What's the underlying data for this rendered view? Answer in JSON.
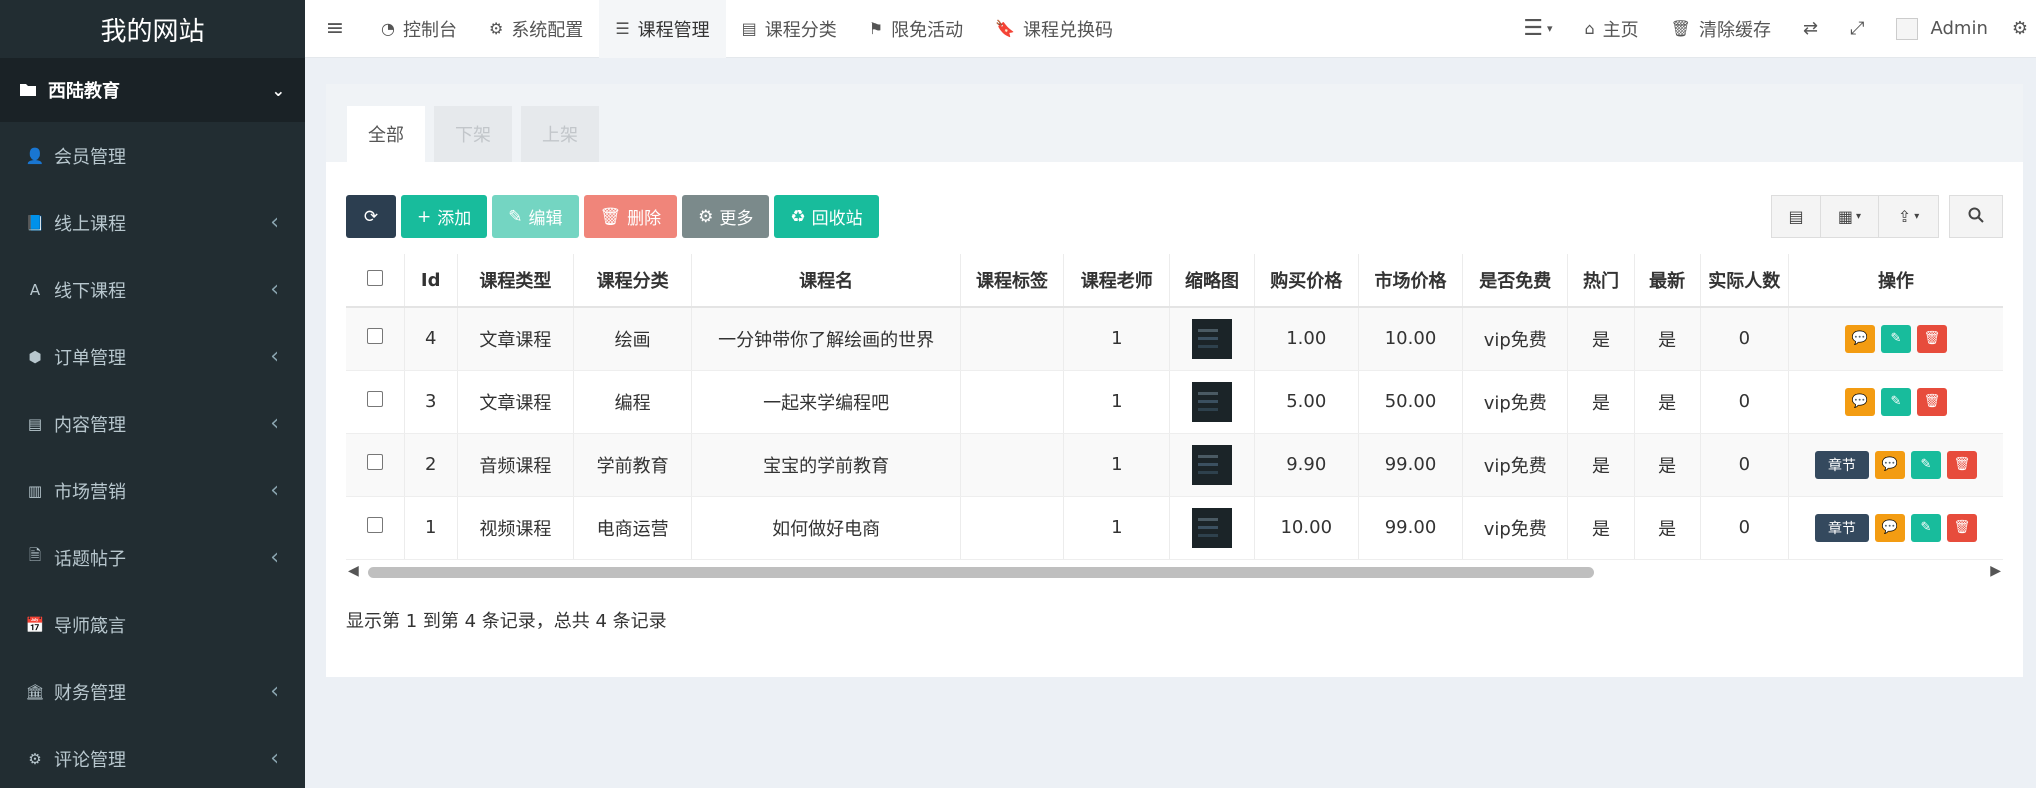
{
  "sidebar": {
    "logo": "我的网站",
    "group": {
      "label": "西陆教育",
      "icon": "folder-icon"
    },
    "items": [
      {
        "label": "会员管理",
        "icon": "user-icon",
        "has_arrow": false
      },
      {
        "label": "线上课程",
        "icon": "book-icon",
        "has_arrow": true
      },
      {
        "label": "线下课程",
        "icon": "font-icon",
        "has_arrow": true
      },
      {
        "label": "订单管理",
        "icon": "cube-icon",
        "has_arrow": true
      },
      {
        "label": "内容管理",
        "icon": "list-alt-icon",
        "has_arrow": true
      },
      {
        "label": "市场营销",
        "icon": "bar-chart-icon",
        "has_arrow": true
      },
      {
        "label": "话题帖子",
        "icon": "file-icon",
        "has_arrow": true
      },
      {
        "label": "导师箴言",
        "icon": "calendar-icon",
        "has_arrow": false
      },
      {
        "label": "财务管理",
        "icon": "bank-icon",
        "has_arrow": true
      },
      {
        "label": "评论管理",
        "icon": "gear-icon",
        "has_arrow": true
      }
    ]
  },
  "topnav": {
    "tabs": [
      {
        "label": "控制台",
        "icon": "dashboard-icon"
      },
      {
        "label": "系统配置",
        "icon": "gear-icon"
      },
      {
        "label": "课程管理",
        "icon": "list-icon",
        "active": true
      },
      {
        "label": "课程分类",
        "icon": "list-alt-icon"
      },
      {
        "label": "限免活动",
        "icon": "flag-icon"
      },
      {
        "label": "课程兑换码",
        "icon": "bookmark-icon"
      }
    ],
    "right": {
      "home": "主页",
      "clear_cache": "清除缓存",
      "user": "Admin"
    }
  },
  "content": {
    "tabs": {
      "all": "全部",
      "off": "下架",
      "on": "上架"
    },
    "toolbar": {
      "add": "添加",
      "edit": "编辑",
      "delete": "删除",
      "more": "更多",
      "recycle": "回收站"
    },
    "table": {
      "headers": [
        "Id",
        "课程类型",
        "课程分类",
        "课程名",
        "课程标签",
        "课程老师",
        "缩略图",
        "购买价格",
        "市场价格",
        "是否免费",
        "热门",
        "最新",
        "实际人数",
        "操作"
      ],
      "rows": [
        {
          "id": "4",
          "type": "文章课程",
          "type_color": "red",
          "category": "绘画",
          "name": "一分钟带你了解绘画的世界",
          "tag": "",
          "teacher": "1",
          "price": "1.00",
          "market": "10.00",
          "free": "vip免费",
          "hot": "是",
          "new": "是",
          "count": "0",
          "chapter": ""
        },
        {
          "id": "3",
          "type": "文章课程",
          "type_color": "red",
          "category": "编程",
          "name": "一起来学编程吧",
          "tag": "",
          "teacher": "1",
          "price": "5.00",
          "market": "50.00",
          "free": "vip免费",
          "hot": "是",
          "new": "是",
          "count": "0",
          "chapter": ""
        },
        {
          "id": "2",
          "type": "音频课程",
          "type_color": "green",
          "category": "学前教育",
          "name": "宝宝的学前教育",
          "tag": "",
          "teacher": "1",
          "price": "9.90",
          "market": "99.00",
          "free": "vip免费",
          "hot": "是",
          "new": "是",
          "count": "0",
          "chapter": "章节"
        },
        {
          "id": "1",
          "type": "视频课程",
          "type_color": "plain",
          "category": "电商运营",
          "name": "如何做好电商",
          "tag": "",
          "teacher": "1",
          "price": "10.00",
          "market": "99.00",
          "free": "vip免费",
          "hot": "是",
          "new": "是",
          "count": "0",
          "chapter": "章节"
        }
      ]
    },
    "summary": "显示第 1 到第 4 条记录，总共 4 条记录"
  }
}
